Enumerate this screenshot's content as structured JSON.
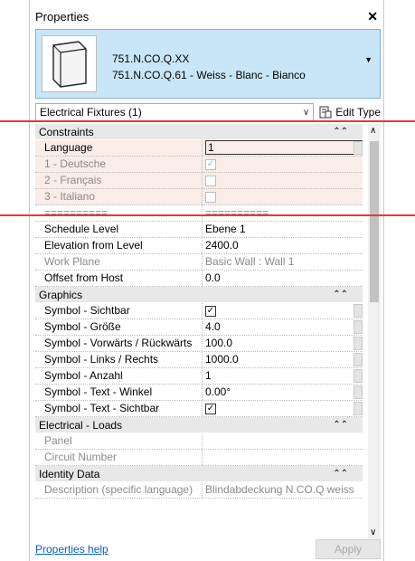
{
  "window": {
    "title": "Properties",
    "close_glyph": "✕"
  },
  "type_selector": {
    "line1": "751.N.CO.Q.XX",
    "line2": "751.N.CO.Q.61 - Weiss - Blanc - Bianco",
    "dropdown_glyph": "▼",
    "thumbnail_icon": "cover-plate-thumbnail"
  },
  "category": {
    "label": "Electrical Fixtures (1)",
    "chevron": "∨",
    "edit_type_label": "Edit Type",
    "edit_type_icon": "edit-type-icon"
  },
  "groups": [
    {
      "id": "constraints",
      "label": "Constraints",
      "collapse": "⌃⌃",
      "rows": [
        {
          "name": "Language",
          "value": "1",
          "kind": "input",
          "dim": false,
          "highlight": true
        },
        {
          "name": "1 - Deutsche",
          "value": "",
          "kind": "checkbox",
          "checked": true,
          "dim": true,
          "highlight": true
        },
        {
          "name": "2 - Français",
          "value": "",
          "kind": "checkbox",
          "checked": false,
          "dim": true,
          "highlight": true
        },
        {
          "name": "3 - Italiano",
          "value": "",
          "kind": "checkbox",
          "checked": false,
          "dim": true,
          "highlight": true
        },
        {
          "name": "==========",
          "value": "==========",
          "kind": "text",
          "dim": true,
          "highlight": false
        },
        {
          "name": "Schedule Level",
          "value": "Ebene 1",
          "kind": "text",
          "dim": false,
          "highlight": false
        },
        {
          "name": "Elevation from Level",
          "value": "2400.0",
          "kind": "text",
          "dim": false,
          "highlight": false
        },
        {
          "name": "Work Plane",
          "value": "Basic Wall : Wall 1",
          "kind": "text",
          "dim": true,
          "highlight": false
        },
        {
          "name": "Offset from Host",
          "value": "0.0",
          "kind": "text",
          "dim": false,
          "highlight": false
        }
      ]
    },
    {
      "id": "graphics",
      "label": "Graphics",
      "collapse": "⌃⌃",
      "rows": [
        {
          "name": "Symbol - Sichtbar",
          "value": "",
          "kind": "checkbox",
          "checked": true,
          "dim": false,
          "highlight": false
        },
        {
          "name": "Symbol - Größe",
          "value": "4.0",
          "kind": "text",
          "dim": false,
          "highlight": false
        },
        {
          "name": "Symbol - Vorwärts / Rückwärts",
          "value": "100.0",
          "kind": "text",
          "dim": false,
          "highlight": false
        },
        {
          "name": "Symbol - Links / Rechts",
          "value": "1000.0",
          "kind": "text",
          "dim": false,
          "highlight": false
        },
        {
          "name": "Symbol - Anzahl",
          "value": "1",
          "kind": "text",
          "dim": false,
          "highlight": false
        },
        {
          "name": "Symbol - Text - Winkel",
          "value": "0.00°",
          "kind": "text",
          "dim": false,
          "highlight": false
        },
        {
          "name": "Symbol - Text - Sichtbar",
          "value": "",
          "kind": "checkbox",
          "checked": true,
          "dim": false,
          "highlight": false
        }
      ]
    },
    {
      "id": "electrical-loads",
      "label": "Electrical - Loads",
      "collapse": "⌃⌃",
      "rows": [
        {
          "name": "Panel",
          "value": "",
          "kind": "text",
          "dim": true,
          "highlight": false
        },
        {
          "name": "Circuit Number",
          "value": "",
          "kind": "text",
          "dim": true,
          "highlight": false
        }
      ]
    },
    {
      "id": "identity-data",
      "label": "Identity Data",
      "collapse": "⌃⌃",
      "rows": [
        {
          "name": "Description (specific language)",
          "value": "Blindabdeckung N.CO.Q weiss",
          "kind": "text",
          "dim": true,
          "highlight": false
        }
      ]
    }
  ],
  "scrollbar": {
    "up": "∧",
    "down": "∨"
  },
  "footer": {
    "help_link": "Properties help",
    "apply_label": "Apply"
  },
  "colors": {
    "type_selector_bg": "#c9e6f8",
    "highlight_row": "#faece6",
    "annotation_red": "#e53935",
    "link": "#0a5fbf"
  }
}
